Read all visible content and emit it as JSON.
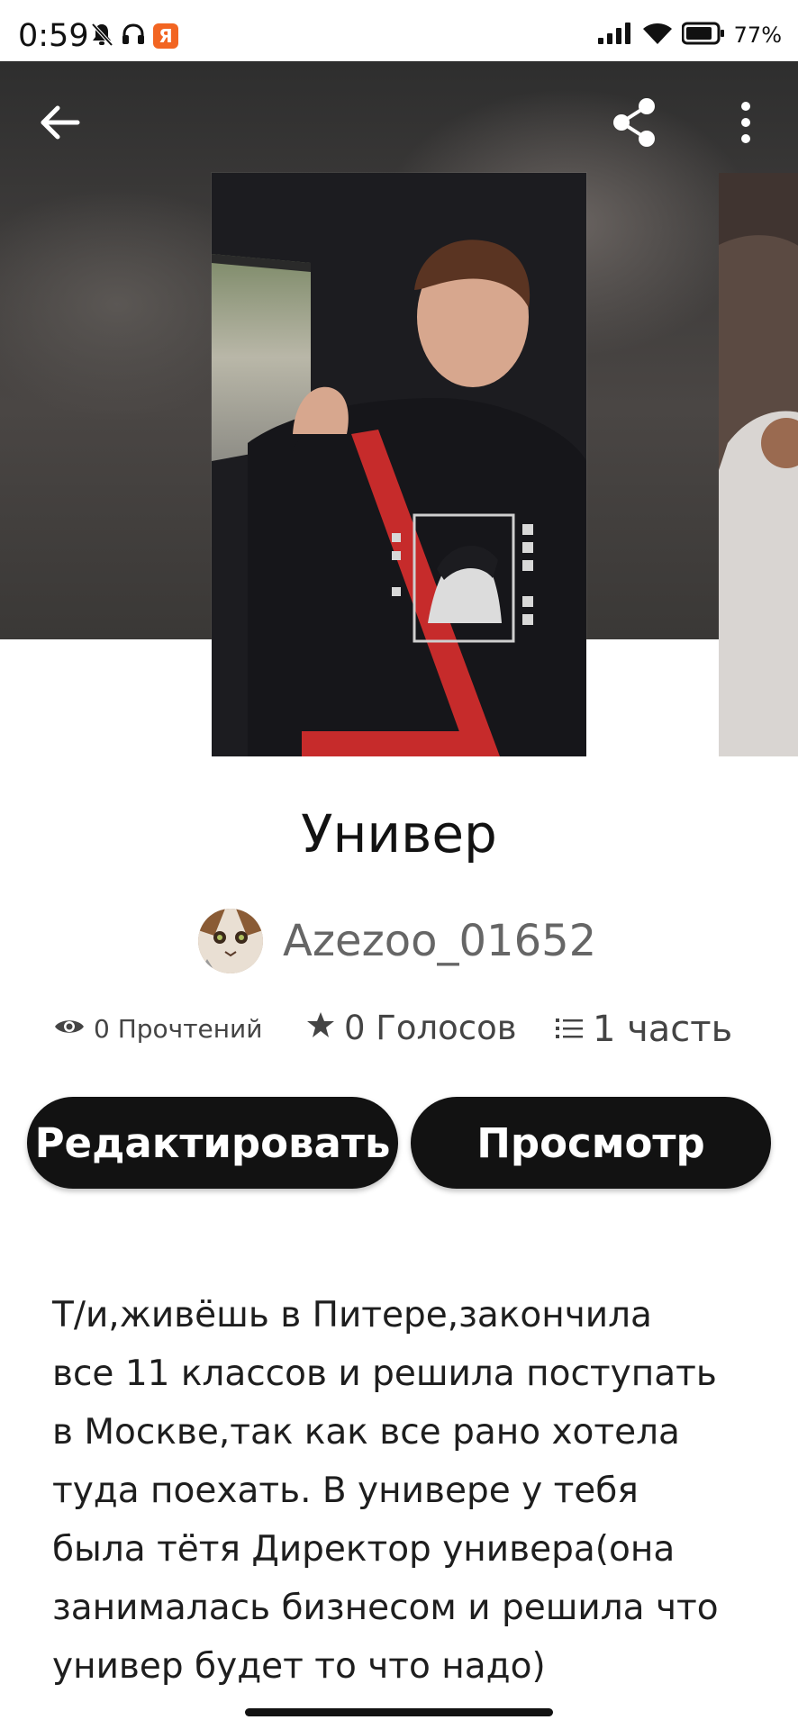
{
  "status_bar": {
    "time": "0:59",
    "badge": "Я",
    "battery": "77%",
    "icons": [
      "bell-off-icon",
      "headphones-icon",
      "yandex-icon",
      "signal-icon",
      "wifi-icon",
      "battery-icon"
    ]
  },
  "header": {
    "back_icon": "arrow-left-icon",
    "share_icon": "share-icon",
    "more_icon": "more-vertical-icon"
  },
  "story": {
    "title": "Универ",
    "author": "Azezoo_01652",
    "stats": {
      "reads": "0 Прочтений",
      "votes": "0 Голосов",
      "parts": "1 часть"
    },
    "description": "Т/и,живёшь в Питере,закончила\nвсе 11 классов и решила поступать\nв Москве,так как все рано хотела\nтуда поехать. В универе у тебя\nбыла тётя Директор универа(она\nзанималась бизнесом и решила что\nунивер будет то что надо)"
  },
  "actions": {
    "edit_label": "Редактировать",
    "view_label": "Просмотр"
  },
  "colors": {
    "button_bg": "#121212",
    "text_primary": "#121212",
    "text_secondary": "#666666"
  }
}
